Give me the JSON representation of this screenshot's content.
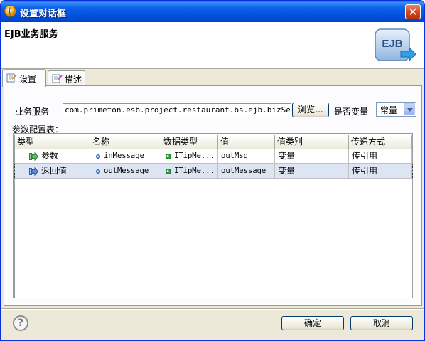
{
  "window": {
    "title": "设置对话框"
  },
  "banner": {
    "title": "EJB业务服务",
    "icon_text": "EJB"
  },
  "tabs": [
    {
      "label": "设置",
      "icon": "settings-page-icon",
      "active": true
    },
    {
      "label": "描述",
      "icon": "description-page-icon",
      "active": false
    }
  ],
  "form": {
    "service_label": "业务服务",
    "service_value": "com.primeton.esb.project.restaurant.bs.ejb.bizService",
    "browse_label": "浏览...",
    "is_variable_label": "是否变量",
    "variable_select": "常量"
  },
  "table": {
    "caption": "参数配置表：",
    "columns": [
      "类型",
      "名称",
      "数据类型",
      "值",
      "值类别",
      "传递方式"
    ],
    "rows": [
      {
        "type": "参数",
        "type_icon": "param-in-icon",
        "name": "inMessage",
        "datatype": "ITipMe...",
        "value": "outMsg",
        "value_category": "变量",
        "pass_mode": "传引用",
        "selected": false
      },
      {
        "type": "返回值",
        "type_icon": "return-value-icon",
        "name": "outMessage",
        "datatype": "ITipMe...",
        "value": "outMessage",
        "value_category": "变量",
        "pass_mode": "传引用",
        "selected": true
      }
    ]
  },
  "footer": {
    "ok_label": "确定",
    "cancel_label": "取消",
    "help_icon": "help-icon",
    "help_glyph": "?"
  },
  "colors": {
    "titlebar": "#0a5fea",
    "selection": "#dde4f2",
    "tab_accent": "#f0a02a"
  }
}
